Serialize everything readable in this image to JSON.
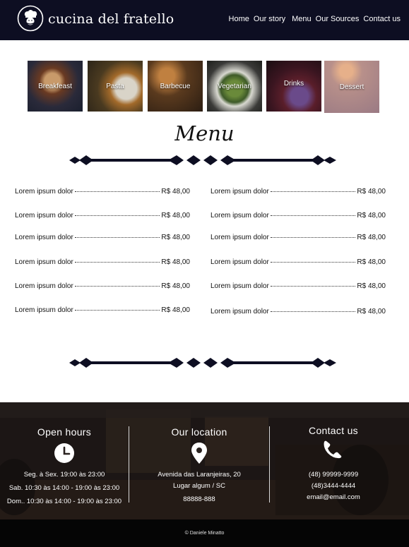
{
  "header": {
    "brand": "cucina del fratello",
    "nav": [
      "Home",
      "Our story",
      "Menu",
      "Our Sources",
      "Contact us"
    ]
  },
  "categories": [
    "Breakfeast",
    "Pasta",
    "Barbecue",
    "Vegetarian",
    "Drinks",
    "Dessert"
  ],
  "menu": {
    "title": "Menu",
    "left": [
      {
        "name": "Lorem ipsum dolor",
        "price": "R$ 48,00"
      },
      {
        "name": "Lorem ipsum dolor",
        "price": "R$ 48,00"
      },
      {
        "name": "Lorem ipsum dolor",
        "price": "R$ 48,00"
      },
      {
        "name": "Lorem ipsum dolor",
        "price": "R$ 48,00"
      },
      {
        "name": "Lorem ipsum dolor",
        "price": "R$ 48,00"
      },
      {
        "name": "Lorem ipsum dolor",
        "price": "R$ 48,00"
      }
    ],
    "right": [
      {
        "name": "Lorem ipsum dolor",
        "price": "R$ 48,00"
      },
      {
        "name": "Lorem ipsum dolor",
        "price": "R$ 48,00"
      },
      {
        "name": "Lorem ipsum dolor",
        "price": "R$ 48,00"
      },
      {
        "name": "Lorem ipsum dolor",
        "price": "R$ 48,00"
      },
      {
        "name": "Lorem ipsum dolor",
        "price": "R$ 48,00"
      },
      {
        "name": "Lorem ipsum dolor",
        "price": "R$ 48,00"
      }
    ]
  },
  "footer": {
    "hours": {
      "title": "Open hours",
      "icon": "clock-icon",
      "lines": [
        "Seg. à Sex. 19:00 às 23:00",
        "Sab. 10:30 às 14:00 - 19:00 às 23:00",
        "Dom.. 10:30 às 14:00 - 19:00 às 23:00"
      ]
    },
    "location": {
      "title": "Our location",
      "icon": "map-pin-icon",
      "lines": [
        "Avenida das Laranjeiras, 20",
        "Lugar algum / SC",
        "88888-888"
      ]
    },
    "contact": {
      "title": "Contact us",
      "icon": "phone-icon",
      "lines": [
        "(48) 99999-9999",
        "(48)3444-4444",
        "email@email.com"
      ]
    },
    "copyright": "© Daniele Minatto"
  },
  "colors": {
    "header_bg": "#0d0e22",
    "divider": "#0d0e22",
    "footer_bar": "#050505"
  }
}
